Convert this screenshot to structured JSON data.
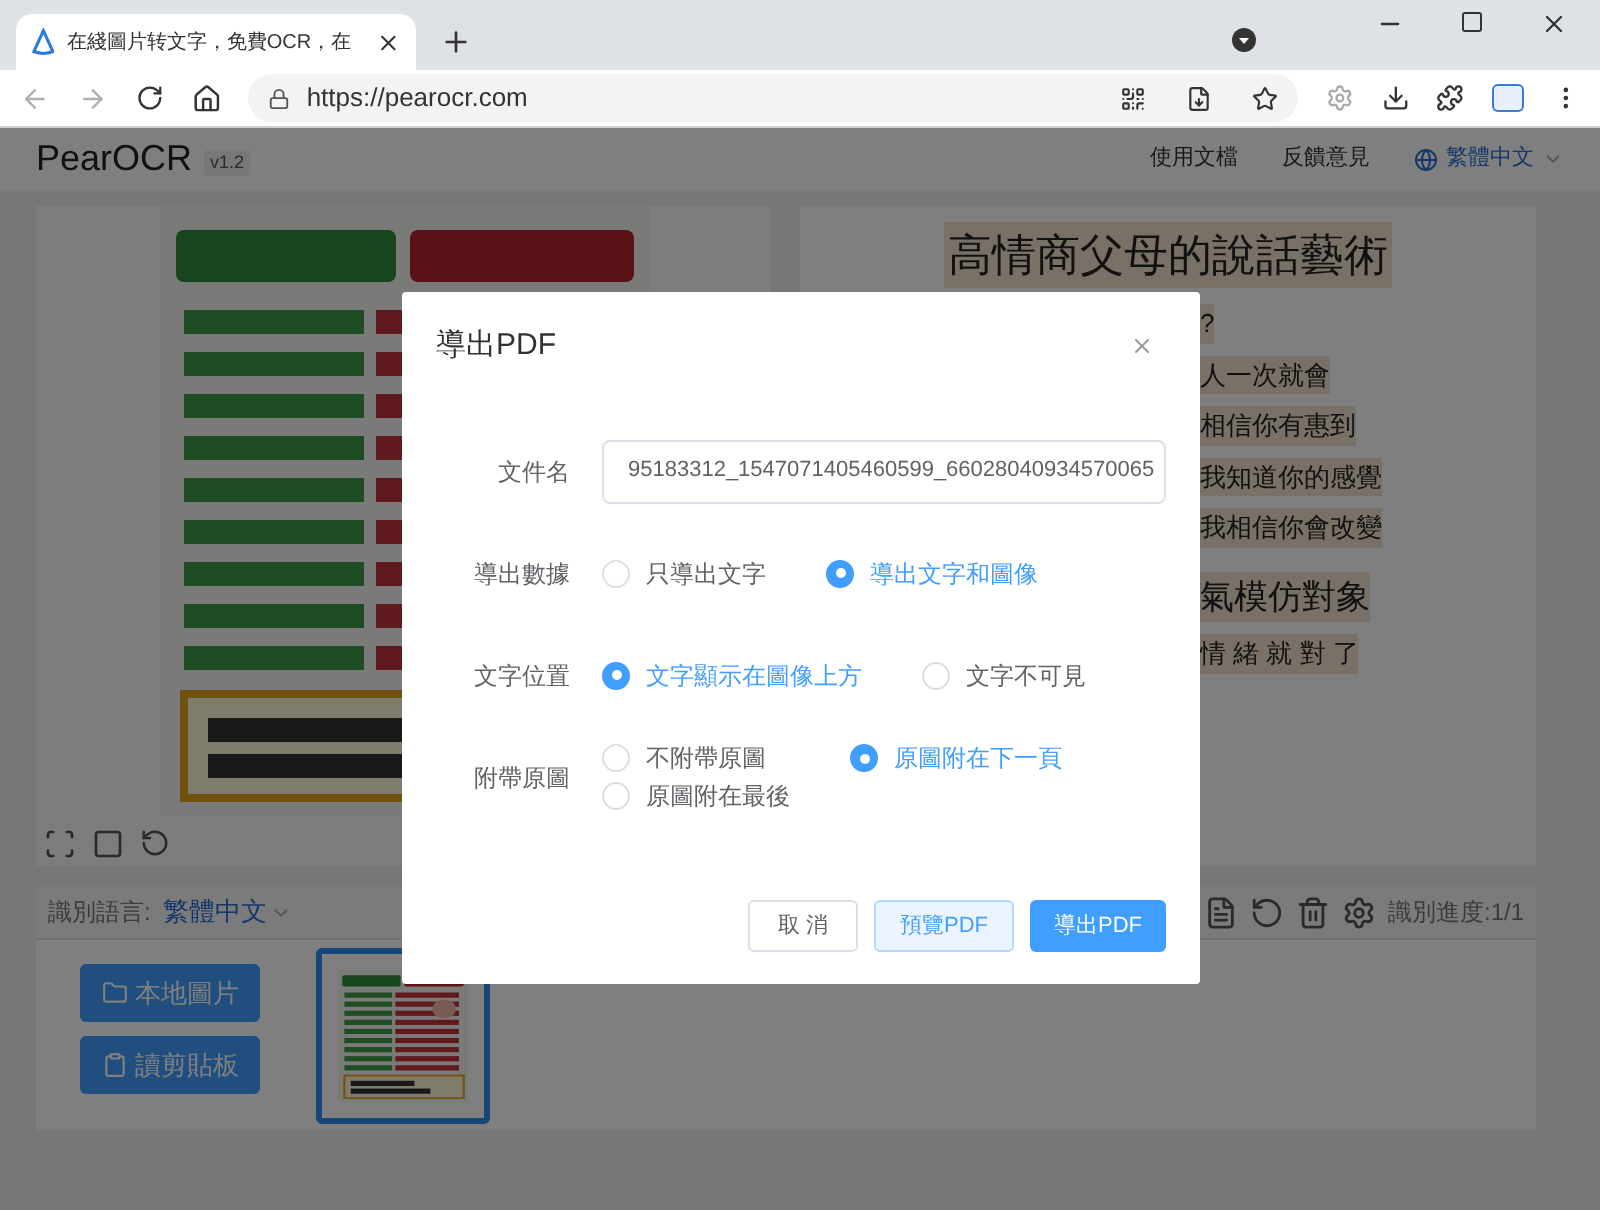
{
  "browser": {
    "tab_title": "在綫圖片转文字，免費OCR，在",
    "url": "https://pearocr.com"
  },
  "header": {
    "brand": "PearOCR",
    "version": "v1.2",
    "links": [
      "使用文檔",
      "反饋意見"
    ],
    "language": "繁體中文"
  },
  "result_panel": {
    "title": "高情商父母的說話藝術",
    "lines": [
      {
        "text": "?",
        "kind": "line"
      },
      {
        "text": "人一次就會",
        "kind": "line"
      },
      {
        "text": "相信你有惠到",
        "kind": "line"
      },
      {
        "text": "我知道你的感覺",
        "kind": "line"
      },
      {
        "text": "我相信你會改變",
        "kind": "line"
      },
      {
        "text": "氣模仿對象",
        "kind": "heading"
      },
      {
        "text": "情 緒 就 對 了",
        "kind": "line"
      }
    ]
  },
  "toolbar": {
    "language_label": "識別語言:",
    "language": "繁體中文",
    "progress": "識別進度:1/1"
  },
  "upload_buttons": [
    {
      "label": "本地圖片",
      "kind": "folder"
    },
    {
      "label": "讀剪貼板",
      "kind": "clipboard"
    }
  ],
  "dialog": {
    "title": "導出PDF",
    "fields": [
      {
        "kind": "text",
        "label": "文件名",
        "value": "95183312_1547071405460599_66028040934570065"
      },
      {
        "kind": "radio",
        "label": "導出數據",
        "options": [
          {
            "label": "只導出文字",
            "selected": false
          },
          {
            "label": "導出文字和圖像",
            "selected": true
          }
        ]
      },
      {
        "kind": "radio",
        "label": "文字位置",
        "options": [
          {
            "label": "文字顯示在圖像上方",
            "selected": true
          },
          {
            "label": "文字不可見",
            "selected": false
          }
        ]
      },
      {
        "kind": "radio_grid",
        "label": "附帶原圖",
        "options": [
          {
            "label": "不附帶原圖",
            "selected": false
          },
          {
            "label": "原圖附在最後",
            "selected": false
          },
          {
            "label": "原圖附在下一頁",
            "selected": true
          }
        ]
      }
    ],
    "buttons": [
      {
        "label": "取 消",
        "kind": "default"
      },
      {
        "label": "預覽PDF",
        "kind": "light"
      },
      {
        "label": "導出PDF",
        "kind": "primary"
      }
    ]
  }
}
